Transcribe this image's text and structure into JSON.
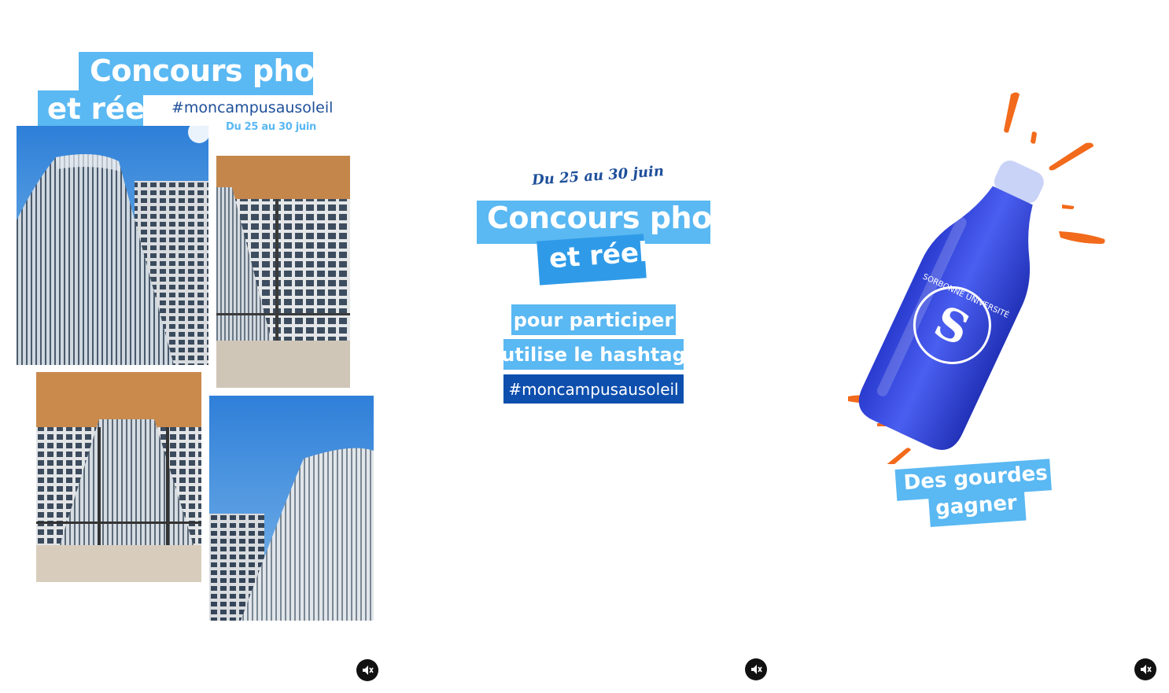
{
  "panel1": {
    "title": "Concours photo",
    "subtitle": "et réel",
    "hashtag": "#moncampusausoleil",
    "dates": "Du 25 au 30 juin"
  },
  "panel2": {
    "dates": "Du 25 au 30 juin",
    "title": "Concours photo",
    "subtitle": "et réel",
    "line1": "pour participer",
    "line2": "utilise le hashtag",
    "hashtag": "#moncampusausoleil"
  },
  "panel3": {
    "caption_line1": "Des gourdes à",
    "caption_line2": "gagner !",
    "bottle_logo": "SORBONNE UNIVERSITÉ"
  },
  "mute_icons": [
    "muted-speaker-icon",
    "muted-speaker-icon",
    "muted-speaker-icon"
  ],
  "colors": {
    "light_blue": "#5ab8f2",
    "dark_blue": "#0e4fae",
    "navy_text": "#1e4f9a",
    "orange": "#f26a1b",
    "bottle_blue": "#3b4fe0"
  }
}
